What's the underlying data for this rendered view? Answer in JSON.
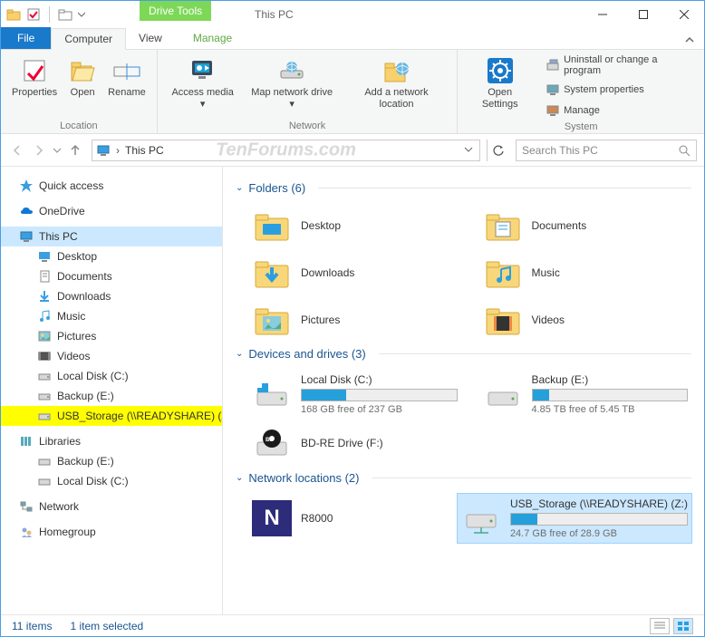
{
  "titlebar": {
    "drive_tools": "Drive Tools",
    "title": "This PC"
  },
  "ribbon_tabs": {
    "file": "File",
    "computer": "Computer",
    "view": "View",
    "manage": "Manage"
  },
  "ribbon": {
    "location": {
      "label": "Location",
      "properties": "Properties",
      "open": "Open",
      "rename": "Rename"
    },
    "network": {
      "label": "Network",
      "access_media": "Access media",
      "map_drive": "Map network drive",
      "add_location": "Add a network location"
    },
    "system": {
      "label": "System",
      "open_settings": "Open Settings",
      "uninstall": "Uninstall or change a program",
      "properties": "System properties",
      "manage": "Manage"
    }
  },
  "address": {
    "path": "This PC",
    "search_placeholder": "Search This PC"
  },
  "watermark": "TenForums.com",
  "tree": {
    "quick_access": "Quick access",
    "onedrive": "OneDrive",
    "this_pc": "This PC",
    "children": [
      "Desktop",
      "Documents",
      "Downloads",
      "Music",
      "Pictures",
      "Videos",
      "Local Disk (C:)",
      "Backup (E:)",
      "USB_Storage (\\\\READYSHARE) (Z:)"
    ],
    "libraries": "Libraries",
    "lib_children": [
      "Backup (E:)",
      "Local Disk (C:)"
    ],
    "network": "Network",
    "homegroup": "Homegroup"
  },
  "content": {
    "folders_header": "Folders (6)",
    "folders": [
      "Desktop",
      "Documents",
      "Downloads",
      "Music",
      "Pictures",
      "Videos"
    ],
    "drives_header": "Devices and drives (3)",
    "drives": [
      {
        "name": "Local Disk (C:)",
        "free": "168 GB free of 237 GB",
        "pct": 29
      },
      {
        "name": "Backup (E:)",
        "free": "4.85 TB free of 5.45 TB",
        "pct": 11
      },
      {
        "name": "BD-RE Drive (F:)",
        "free": "",
        "pct": null
      }
    ],
    "network_header": "Network locations (2)",
    "network": {
      "r8000": "R8000",
      "usb": {
        "name": "USB_Storage (\\\\READYSHARE) (Z:)",
        "free": "24.7 GB free of 28.9 GB",
        "pct": 15
      }
    }
  },
  "statusbar": {
    "items": "11 items",
    "selected": "1 item selected"
  }
}
